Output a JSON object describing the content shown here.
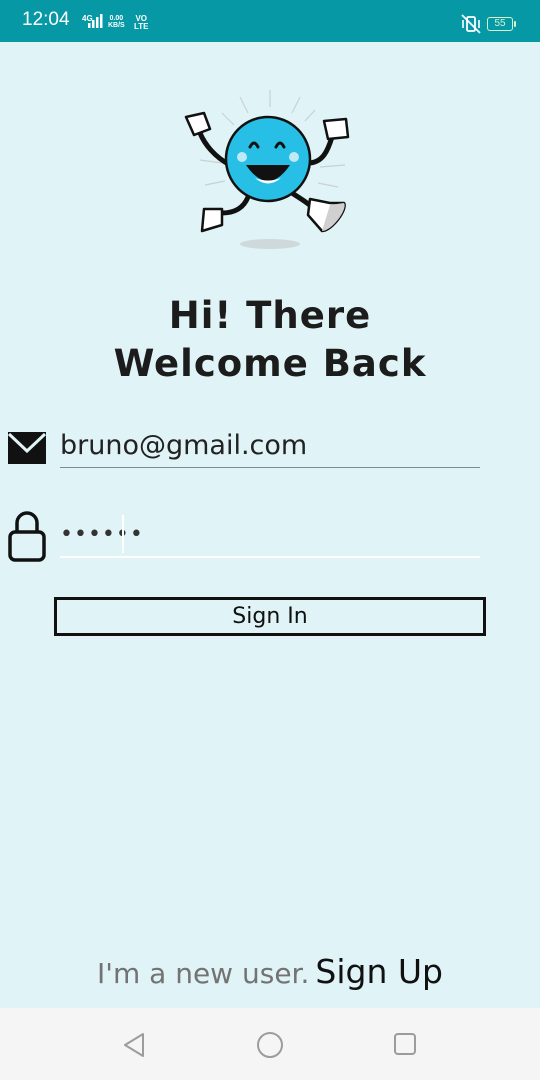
{
  "status_bar": {
    "time": "12:04",
    "signal_label": "4G",
    "net_speed_value": "0.00",
    "net_speed_unit": "KB/S",
    "volte_top": "VO",
    "volte_bottom": "LTE",
    "battery": "55",
    "icons": [
      "signal-icon",
      "vibrate-icon",
      "battery-icon"
    ],
    "background_color": "#0798a5"
  },
  "illustration": {
    "icon": "happy-mascot-icon",
    "accent_color": "#27bfe6"
  },
  "heading": {
    "line1": "Hi! There",
    "line2": "Welcome Back"
  },
  "form": {
    "email_icon": "mail-icon",
    "email_value": "bruno@gmail.com",
    "password_icon": "lock-icon",
    "password_value": "••••••",
    "signin_label": "Sign In"
  },
  "footer": {
    "new_user_text": "I'm a new user.",
    "signup_label": "Sign Up"
  },
  "nav_bar": {
    "icons": [
      "back-icon",
      "home-icon",
      "recent-apps-icon"
    ]
  },
  "colors": {
    "background": "#e0f3f6",
    "text": "#111111"
  }
}
